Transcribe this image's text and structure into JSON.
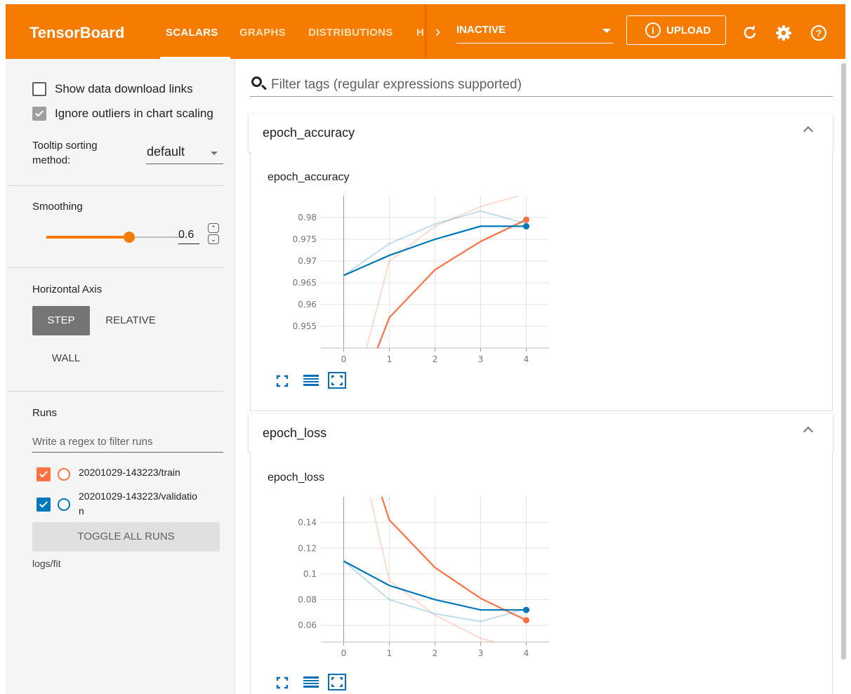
{
  "header": {
    "brand": "TensorBoard",
    "tabs": [
      {
        "label": "SCALARS",
        "active": true
      },
      {
        "label": "GRAPHS",
        "active": false
      },
      {
        "label": "DISTRIBUTIONS",
        "active": false
      },
      {
        "label": "H",
        "active": false
      }
    ],
    "plugin_select_value": "INACTIVE",
    "upload_label": "UPLOAD",
    "icons": [
      "chevron-right-icon",
      "info-icon",
      "refresh-icon",
      "gear-icon",
      "help-icon"
    ],
    "bar_color": "#f57c00"
  },
  "sidebar": {
    "show_download_links_label": "Show data download links",
    "show_download_links_checked": false,
    "ignore_outliers_label": "Ignore outliers in chart scaling",
    "ignore_outliers_checked": true,
    "tooltip_sorting_label_line1": "Tooltip sorting",
    "tooltip_sorting_label_line2": "method:",
    "tooltip_sorting_value": "default",
    "smoothing_label": "Smoothing",
    "smoothing_value": "0.6",
    "smoothing_fraction": 0.6,
    "horizontal_axis_label": "Horizontal Axis",
    "axis_options": [
      {
        "label": "STEP",
        "selected": true
      },
      {
        "label": "RELATIVE",
        "selected": false
      },
      {
        "label": "WALL",
        "selected": false
      }
    ],
    "runs_label": "Runs",
    "runs_filter_placeholder": "Write a regex to filter runs",
    "runs": [
      {
        "name": "20201029-143223/train",
        "checked": true,
        "color": "#ff7043"
      },
      {
        "name_line1": "20201029-143223/validatio",
        "name_line2": "n",
        "checked": true,
        "color": "#0077bb"
      }
    ],
    "toggle_all_label": "TOGGLE ALL RUNS",
    "logdir": "logs/fit"
  },
  "main": {
    "filter_placeholder": "Filter tags (regular expressions supported)",
    "cards": [
      {
        "header": "epoch_accuracy",
        "chart_title": "epoch_accuracy"
      },
      {
        "header": "epoch_loss",
        "chart_title": "epoch_loss"
      }
    ]
  },
  "chart_data": [
    {
      "type": "line",
      "title": "epoch_accuracy",
      "x": [
        0,
        1,
        2,
        3,
        4
      ],
      "xlim": [
        -0.5,
        4.5
      ],
      "ylim": [
        0.95,
        0.985
      ],
      "yticks": [
        0.955,
        0.96,
        0.965,
        0.97,
        0.975,
        0.98
      ],
      "ytick_labels": [
        "0.955",
        "0.96",
        "0.965",
        "0.97",
        "0.975",
        "0.98"
      ],
      "xticks": [
        0,
        1,
        2,
        3,
        4
      ],
      "grid": true,
      "series": [
        {
          "color": "#ff7043",
          "raw": [
            0.93,
            0.97,
            0.978,
            0.9825,
            0.9855
          ],
          "smoothed": [
            0.93,
            0.957,
            0.968,
            0.9745,
            0.9795
          ]
        },
        {
          "color": "#0077bb",
          "raw": [
            0.9667,
            0.974,
            0.9785,
            0.9815,
            0.9786
          ],
          "smoothed": [
            0.9667,
            0.9713,
            0.975,
            0.978,
            0.978
          ]
        }
      ]
    },
    {
      "type": "line",
      "title": "epoch_loss",
      "x": [
        0,
        1,
        2,
        3,
        4
      ],
      "xlim": [
        -0.5,
        4.5
      ],
      "ylim": [
        0.047,
        0.16
      ],
      "yticks": [
        0.06,
        0.08,
        0.1,
        0.12,
        0.14
      ],
      "ytick_labels": [
        "0.06",
        "0.08",
        "0.1",
        "0.12",
        "0.14"
      ],
      "xticks": [
        0,
        1,
        2,
        3,
        4
      ],
      "grid": true,
      "series": [
        {
          "color": "#ff7043",
          "raw": [
            0.25,
            0.095,
            0.068,
            0.05,
            0.04
          ],
          "smoothed": [
            0.25,
            0.142,
            0.105,
            0.081,
            0.064
          ]
        },
        {
          "color": "#0077bb",
          "raw": [
            0.11,
            0.08,
            0.069,
            0.063,
            0.073
          ],
          "smoothed": [
            0.11,
            0.091,
            0.08,
            0.072,
            0.072
          ]
        }
      ]
    }
  ]
}
